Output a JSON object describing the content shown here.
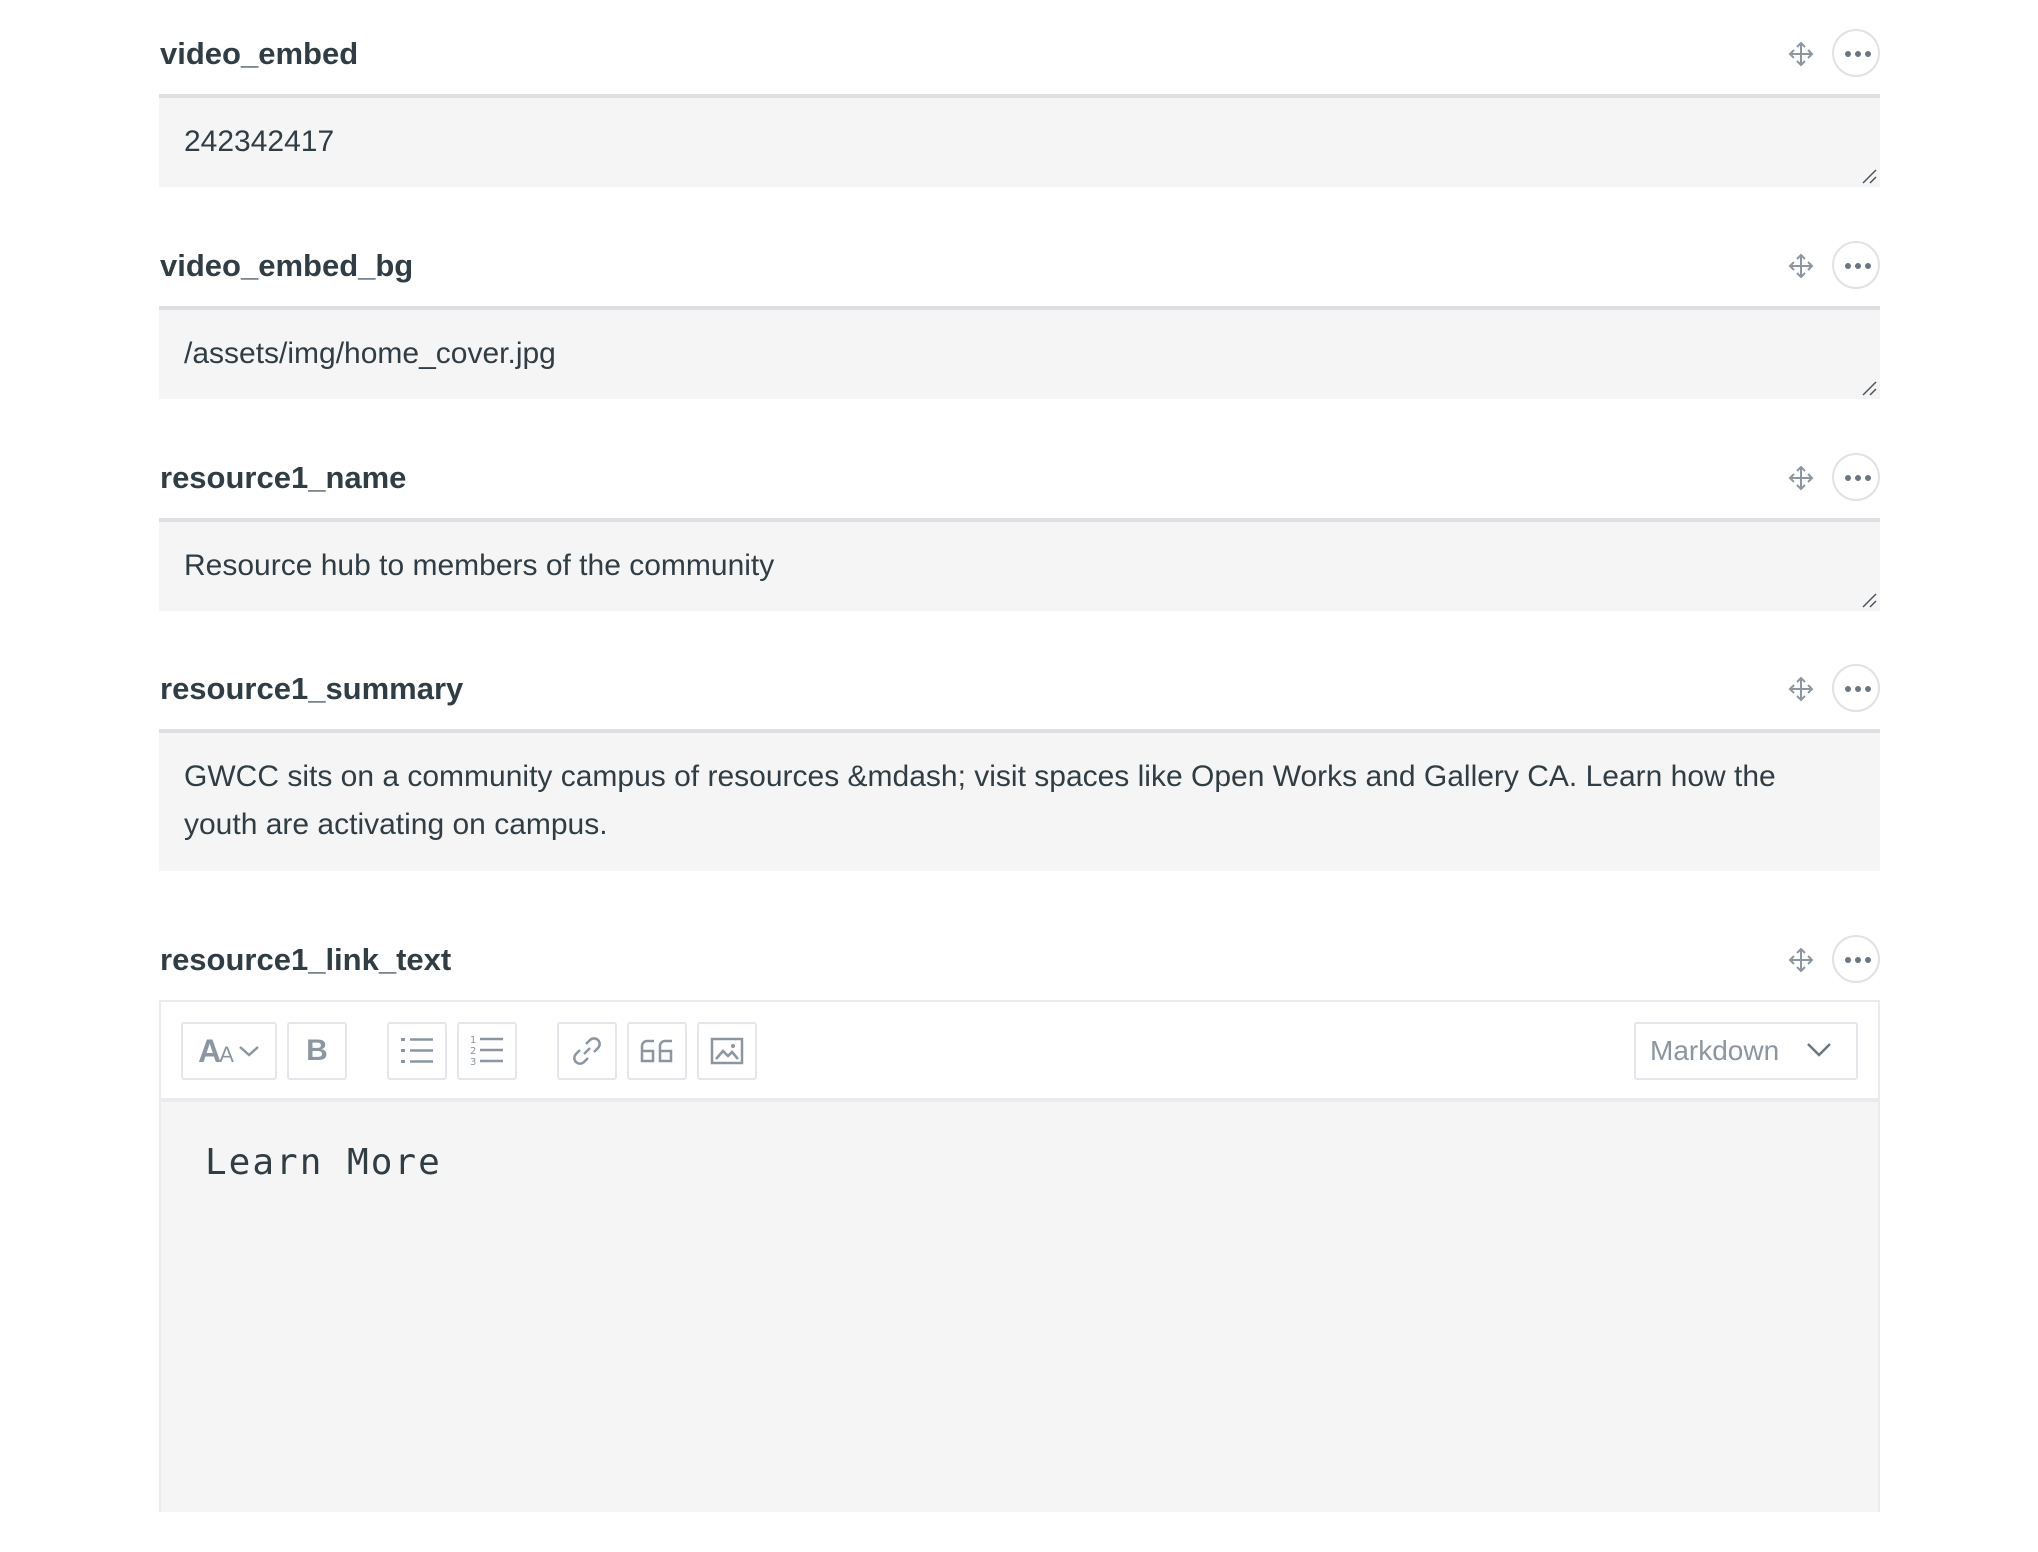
{
  "fields": [
    {
      "label": "video_embed",
      "value": "242342417"
    },
    {
      "label": "video_embed_bg",
      "value": "/assets/img/home_cover.jpg"
    },
    {
      "label": "resource1_name",
      "value": "Resource hub to members of the community"
    },
    {
      "label": "resource1_summary",
      "value": "GWCC sits on a community campus of resources &mdash; visit spaces like Open Works and Gallery CA. Learn how the youth are activating on campus."
    }
  ],
  "editor_field": {
    "label": "resource1_link_text",
    "value": "Learn More",
    "format_select": "Markdown",
    "toolbar": {
      "heading_label": "AA",
      "bold_label": "B"
    }
  },
  "icons": {
    "move": "move-icon",
    "more": "more-horizontal-icon",
    "resize": "resize-grip-icon",
    "heading": "text-size-icon",
    "bold": "bold-icon",
    "bulleted_list": "bulleted-list-icon",
    "numbered_list": "numbered-list-icon",
    "link": "link-icon",
    "quote": "quote-icon",
    "image": "image-icon",
    "chevron": "chevron-down-icon"
  },
  "colors": {
    "label": "#313d45",
    "input_bg": "#f5f5f5",
    "border": "#dfdfe3",
    "icon": "#8b96a1"
  }
}
